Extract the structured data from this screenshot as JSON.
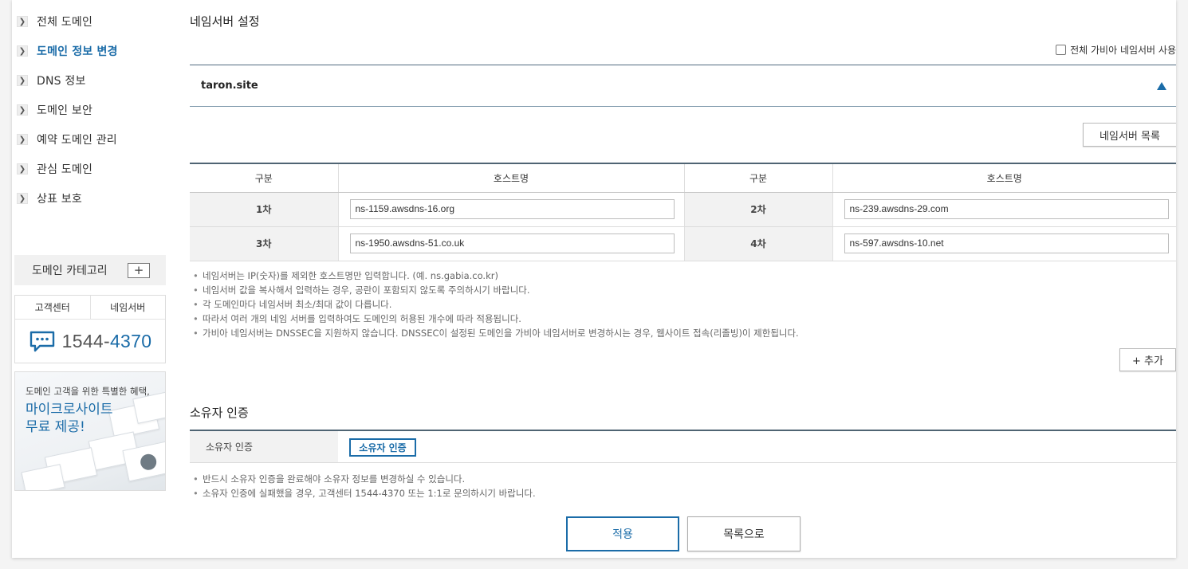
{
  "sidebar": {
    "items": [
      {
        "label": "전체 도메인",
        "active": false
      },
      {
        "label": "도메인 정보 변경",
        "active": true
      },
      {
        "label": "DNS 정보",
        "active": false
      },
      {
        "label": "도메인 보안",
        "active": false
      },
      {
        "label": "예약 도메인 관리",
        "active": false
      },
      {
        "label": "관심 도메인",
        "active": false
      },
      {
        "label": "상표 보호",
        "active": false
      }
    ],
    "category_label": "도메인 카테고리",
    "category_add": "+",
    "support": {
      "tab_customer": "고객센터",
      "tab_nameserver": "네임서버",
      "phone_prefix": "1544-",
      "phone_suffix": "4370"
    },
    "promo": {
      "subtitle": "도메인 고객을 위한 특별한 혜택,",
      "title_line1": "마이크로사이트",
      "title_line2": "무료 제공!"
    }
  },
  "nameserver": {
    "section_title": "네임서버 설정",
    "all_gabia_label": "전체 가비아 네임서버 사용",
    "domain": "taron.site",
    "list_button": "네임서버 목록",
    "headers": {
      "col1": "구분",
      "col2": "호스트명",
      "col3": "구분",
      "col4": "호스트명"
    },
    "rows": [
      {
        "label_a": "1차",
        "host_a": "ns-1159.awsdns-16.org",
        "label_b": "2차",
        "host_b": "ns-239.awsdns-29.com"
      },
      {
        "label_a": "3차",
        "host_a": "ns-1950.awsdns-51.co.uk",
        "label_b": "4차",
        "host_b": "ns-597.awsdns-10.net"
      }
    ],
    "notes": [
      "네임서버는 IP(숫자)를 제외한 호스트명만 입력합니다. (예. ns.gabia.co.kr)",
      "네임서버 값을 복사해서 입력하는 경우, 공란이 포함되지 않도록 주의하시기 바랍니다.",
      "각 도메인마다 네임서버 최소/최대 값이 다릅니다.",
      "따라서 여러 개의 네임 서버를 입력하여도 도메인의 허용된 개수에 따라 적용됩니다.",
      "가비아 네임서버는 DNSSEC을 지원하지 않습니다. DNSSEC이 설정된 도메인을 가비아 네임서버로 변경하시는 경우, 웹사이트 접속(리졸빙)이 제한됩니다."
    ],
    "add_button": "+ 추가"
  },
  "owner": {
    "section_title": "소유자 인증",
    "row_label": "소유자 인증",
    "verify_button": "소유자 인증",
    "notes": [
      "반드시 소유자 인증을 완료해야 소유자 정보를 변경하실 수 있습니다.",
      "소유자 인증에 실패했을 경우, 고객센터 1544-4370 또는 1:1로 문의하시기 바랍니다."
    ]
  },
  "actions": {
    "apply": "적용",
    "back_to_list": "목록으로"
  },
  "colors": {
    "accent": "#1b6ca8",
    "table_border": "#4f6473"
  },
  "icons": [
    "chevron-right-icon",
    "plus-icon",
    "chat-bubble-icon",
    "triangle-up-icon",
    "checkbox-icon"
  ]
}
